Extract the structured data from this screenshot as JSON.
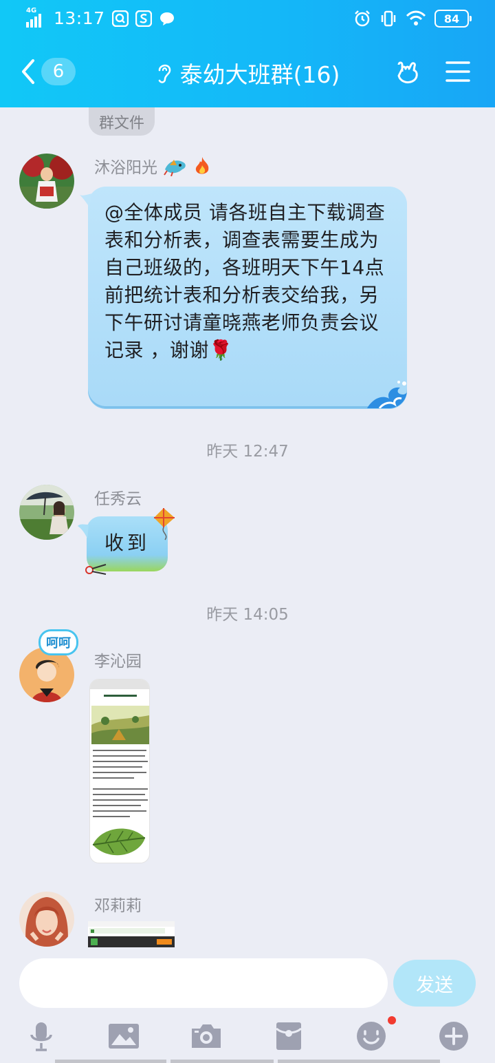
{
  "status_bar": {
    "network": "4G",
    "time": "13:17",
    "battery": "84"
  },
  "header": {
    "unread_count": "6",
    "title": "泰幼大班群(16)"
  },
  "chat": {
    "group_files_label": "群文件",
    "messages": [
      {
        "sender": "沐浴阳光",
        "text": "@全体成员 请各班自主下载调查表和分析表，调查表需要生成为自己班级的，各班明天下午14点前把统计表和分析表交给我，另下午研讨请童晓燕老师负责会议记录 ，谢谢🌹"
      },
      {
        "timestamp": "昨天 12:47",
        "sender": "任秀云",
        "text": "收到"
      },
      {
        "timestamp": "昨天 14:05",
        "sender": "李沁园",
        "avatar_badge": "呵呵"
      },
      {
        "sender": "邓莉莉"
      }
    ]
  },
  "input_bar": {
    "placeholder": "",
    "send_label": "发送"
  },
  "icons": {
    "back": "chevron-left-icon",
    "ear": "ear-icon",
    "gesture": "love-gesture-icon",
    "menu": "hamburger-menu-icon",
    "voice": "microphone-icon",
    "image": "image-icon",
    "camera": "camera-icon",
    "red_packet": "red-packet-icon",
    "emoji": "emoji-icon",
    "plus": "plus-icon"
  },
  "colors": {
    "header_start": "#11c8f7",
    "header_end": "#18a6f6",
    "bubble": "#bfe5fb",
    "background": "#ebedf5",
    "send_button": "#b2e6f9",
    "notify_dot": "#f23b30"
  }
}
